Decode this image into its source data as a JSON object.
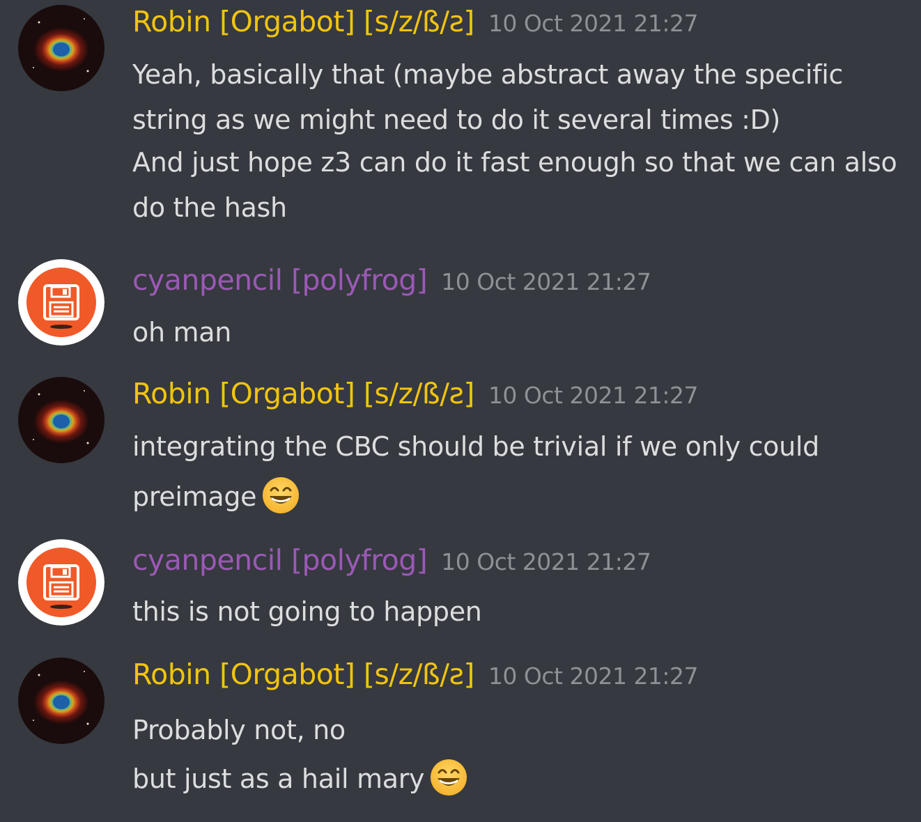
{
  "colors": {
    "background": "#36393f",
    "robin_name": "#f1c40f",
    "cyan_name": "#9b59b6",
    "message_text": "#dcddde",
    "timestamp": "#8e9297"
  },
  "messages": [
    {
      "author": "Robin [Orgabot] [s/z/ß/ꙅ]",
      "timestamp": "10 Oct 2021 21:27",
      "avatar_icon": "helix-nebula-avatar",
      "lines": [
        "Yeah, basically that (maybe abstract away the specific",
        "string as we might need to do it several times :D)",
        "And just hope z3 can do it fast enough so that we can also",
        "do the hash"
      ]
    },
    {
      "author": "cyanpencil [polyfrog]",
      "timestamp": "10 Oct 2021 21:27",
      "avatar_icon": "floppy-disk-avatar",
      "lines": [
        "oh man"
      ]
    },
    {
      "author": "Robin [Orgabot] [s/z/ß/ꙅ]",
      "timestamp": "10 Oct 2021 21:27",
      "avatar_icon": "helix-nebula-avatar",
      "lines": [
        "integrating the CBC should be trivial if we only could",
        "preimage"
      ],
      "emoji": "grinning-face-emoji"
    },
    {
      "author": "cyanpencil [polyfrog]",
      "timestamp": "10 Oct 2021 21:27",
      "avatar_icon": "floppy-disk-avatar",
      "lines": [
        "this is not going to happen"
      ]
    },
    {
      "author": "Robin [Orgabot] [s/z/ß/ꙅ]",
      "timestamp": "10 Oct 2021 21:27",
      "avatar_icon": "helix-nebula-avatar",
      "lines": [
        "Probably not, no",
        "but just as a hail mary"
      ],
      "emoji": "grinning-face-emoji"
    }
  ]
}
